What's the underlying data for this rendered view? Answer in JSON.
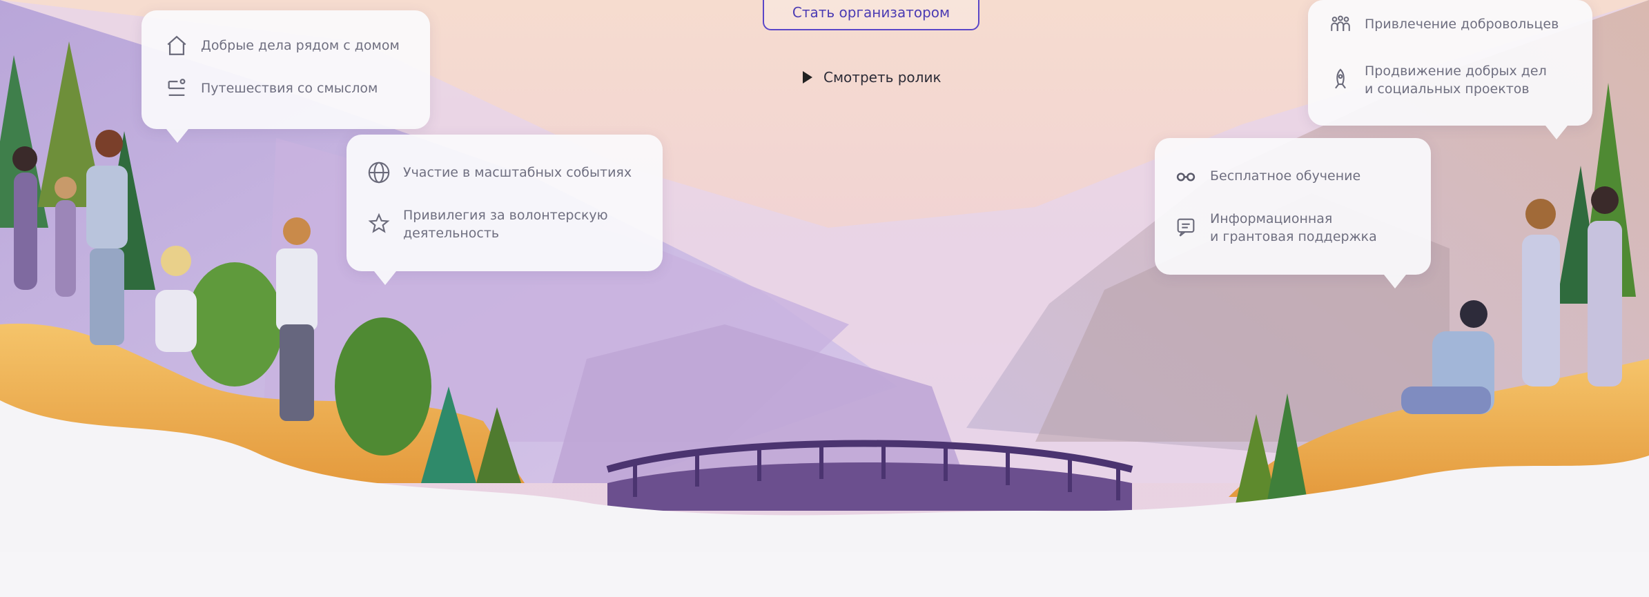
{
  "hero": {
    "cta_label": "Стать организатором",
    "watch_label": "Смотреть ролик"
  },
  "card_left_top": {
    "items": [
      {
        "icon": "home-icon",
        "text": "Добрые дела рядом с домом"
      },
      {
        "icon": "route-icon",
        "text": "Путешествия со смыслом"
      }
    ]
  },
  "card_left_mid": {
    "items": [
      {
        "icon": "globe-icon",
        "text": "Участие в масштабных событиях"
      },
      {
        "icon": "star-icon",
        "text": "Привилегия за волонтерскую деятельность",
        "line1": "Привилегия за волонтерскую",
        "line2": "деятельность"
      }
    ]
  },
  "card_right_top": {
    "items": [
      {
        "icon": "people-icon",
        "text": "Привлечение добровольцев"
      },
      {
        "icon": "rocket-icon",
        "text": "Продвижение добрых дел и социальных проектов",
        "line1": "Продвижение добрых дел",
        "line2": "и социальных проектов"
      }
    ]
  },
  "card_right_mid": {
    "items": [
      {
        "icon": "glasses-icon",
        "text": "Бесплатное обучение"
      },
      {
        "icon": "message-icon",
        "text": "Информационная и грантовая поддержка",
        "line1": "Информационная",
        "line2": "и грантовая поддержка"
      }
    ]
  },
  "colors": {
    "accent": "#5a46c8",
    "sky_top": "#f4e0d6",
    "mountain": "#c9b6df",
    "ground": "#f6f5f8"
  }
}
